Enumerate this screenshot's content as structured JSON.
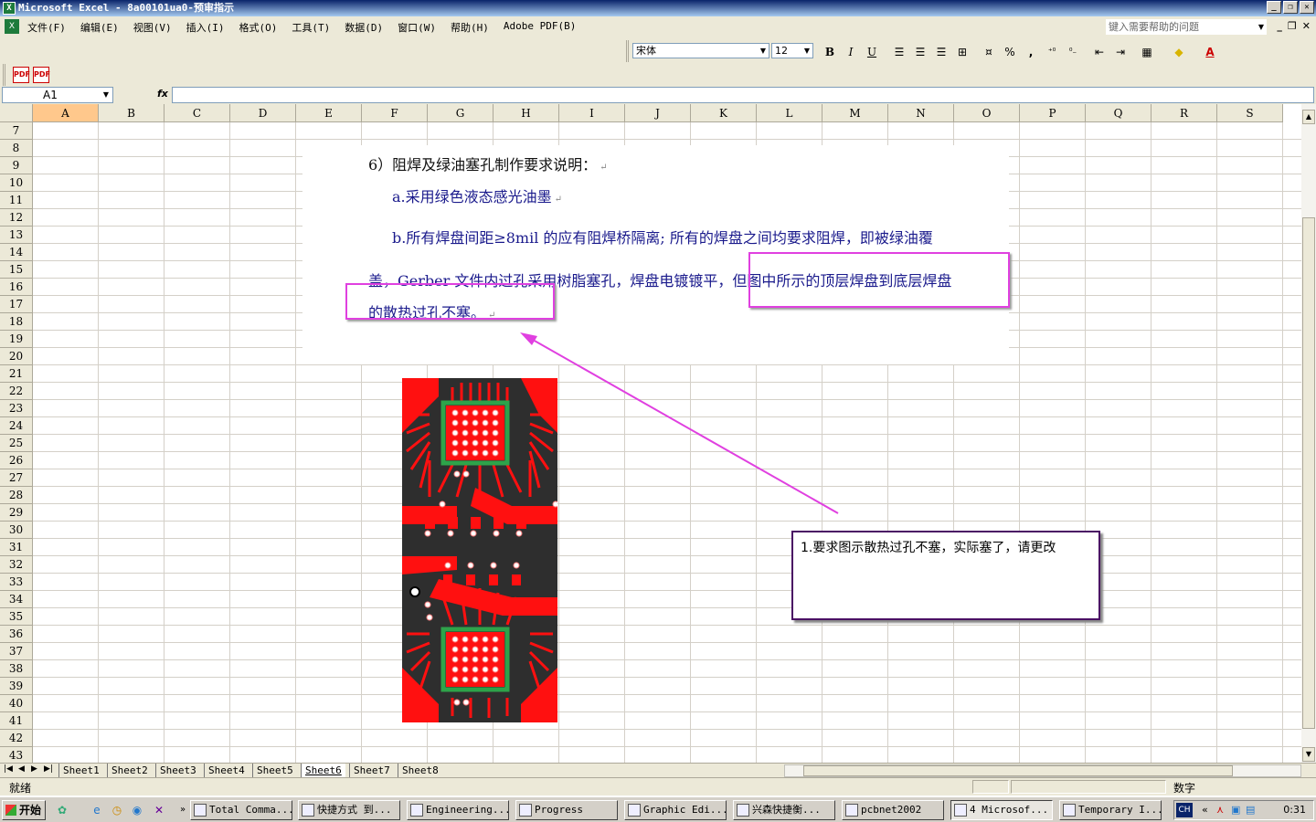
{
  "window": {
    "title": "Microsoft Excel - 8a00101ua0-预审指示",
    "app_icon": "X"
  },
  "menu": {
    "items": [
      "文件(F)",
      "编辑(E)",
      "视图(V)",
      "插入(I)",
      "格式(O)",
      "工具(T)",
      "数据(D)",
      "窗口(W)",
      "帮助(H)",
      "Adobe PDF(B)"
    ],
    "help_placeholder": "键入需要帮助的问题"
  },
  "format_toolbar": {
    "font": "宋体",
    "size": "12",
    "bold": "B",
    "italic": "I",
    "underline": "U",
    "percent": "%",
    "comma": ","
  },
  "formula_bar": {
    "name_box": "A1",
    "fx_label": "fx"
  },
  "columns": [
    "A",
    "B",
    "C",
    "D",
    "E",
    "F",
    "G",
    "H",
    "I",
    "J",
    "K",
    "L",
    "M",
    "N",
    "O",
    "P",
    "Q",
    "R",
    "S"
  ],
  "selected_column": "A",
  "rows": [
    "7",
    "8",
    "9",
    "10",
    "11",
    "12",
    "13",
    "14",
    "15",
    "16",
    "17",
    "18",
    "19",
    "20",
    "21",
    "22",
    "23",
    "24",
    "25",
    "26",
    "27",
    "28",
    "29",
    "30",
    "31",
    "32",
    "33",
    "34",
    "35",
    "36",
    "37",
    "38",
    "39",
    "40",
    "41",
    "42",
    "43"
  ],
  "document": {
    "heading": "6）阻焊及绿油塞孔制作要求说明：",
    "item_a": "a.采用绿色液态感光油墨",
    "item_b": "b.所有焊盘间距≥8mil 的应有阻焊桥隔离; 所有的焊盘之间均要求阻焊，即被绿油覆",
    "line_cont": "盖，Gerber 文件内过孔采用树脂塞孔，焊盘电镀镀平，但图中所示的顶层焊盘到底层焊盘",
    "line_end": "的散热过孔不塞。",
    "return_mark": "↵"
  },
  "comment": {
    "text": "1.要求图示散热过孔不塞，实际塞了，请更改"
  },
  "colors": {
    "highlight": "#e040e0",
    "pcb_copper": "#ff1010",
    "pcb_mask": "#2e2e2e",
    "pcb_pad_ring": "#2ea34a"
  },
  "sheets": {
    "tabs": [
      "Sheet1",
      "Sheet2",
      "Sheet3",
      "Sheet4",
      "Sheet5",
      "Sheet6",
      "Sheet7",
      "Sheet8"
    ],
    "active": "Sheet6"
  },
  "status": {
    "left": "就绪",
    "right": "数字"
  },
  "taskbar": {
    "start": "开始",
    "tasks": [
      "Total Comma...",
      "快捷方式 到...",
      "Engineering...",
      "Progress",
      "Graphic Edi...",
      "兴森快捷衡...",
      "pcbnet2002",
      "4 Microsof...",
      "Temporary I..."
    ],
    "active_task": "4 Microsof...",
    "lang": "CH",
    "clock": "0:31"
  }
}
